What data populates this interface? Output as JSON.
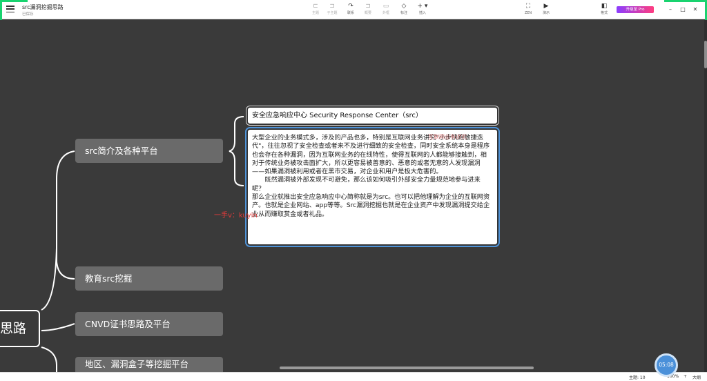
{
  "app": {
    "doc_title": "src漏洞挖掘思路",
    "doc_status": "已保存"
  },
  "toolbar": {
    "items": [
      {
        "label": "主题",
        "icon": "topic-icon"
      },
      {
        "label": "子主题",
        "icon": "subtopic-icon"
      },
      {
        "label": "联系",
        "icon": "relation-icon"
      },
      {
        "label": "概要",
        "icon": "summary-icon"
      },
      {
        "label": "外框",
        "icon": "boundary-icon"
      },
      {
        "label": "标注",
        "icon": "callout-icon"
      },
      {
        "label": "插入",
        "icon": "insert-icon"
      }
    ],
    "right_items": [
      {
        "label": "ZEN",
        "icon": "fullscreen-icon"
      },
      {
        "label": "演示",
        "icon": "play-icon"
      },
      {
        "label": "格式",
        "icon": "format-panel-icon"
      }
    ],
    "pro_label": "升级至 Pro"
  },
  "mindmap": {
    "root_label": "思路",
    "branches": [
      {
        "label": "src简介及各种平台"
      },
      {
        "label": "教育src挖掘"
      },
      {
        "label": "CNVD证书思路及平台"
      },
      {
        "label": "地区、漏洞盒子等挖掘平台"
      }
    ],
    "detail_title": "安全应急响应中心 Security Response Center（src）",
    "detail_paragraphs": [
      "大型企业的业务模式多，涉及的产品也多，特别是互联网业务讲究\"小步快跑敏捷迭代\"，往往忽视了安全检查或者来不及进行细致的安全检查，同时安全系统本身是程序也会存在各种漏洞，因为互联网业务的在线特性，使得互联网的人都能够接触到，相对于传统业务被攻击面扩大，所以更容易被善意的、恶意的或者无意的人发现漏洞——如果漏洞被利用或者在黑市交易，对企业和用户是极大危害的。",
      "既然漏洞被外部发现不可避免，那么该如何吸引外部安全力量规范地参与进来呢？",
      "那么企业就推出安全应急响应中心简称就是为src。也可以把他理解为企业的互联网资产。也就是企业网站、app等等。Src漏洞挖掘也就是在企业资产中发现漏洞提交给企业从而赚取赏金或者礼品。"
    ],
    "watermark": "一手v：kuyin",
    "watermark2": "互联网业务讲究"
  },
  "statusbar": {
    "topics": "主题: 10",
    "zoom": "100%",
    "size_label": "大纲"
  },
  "timer": "05:08"
}
